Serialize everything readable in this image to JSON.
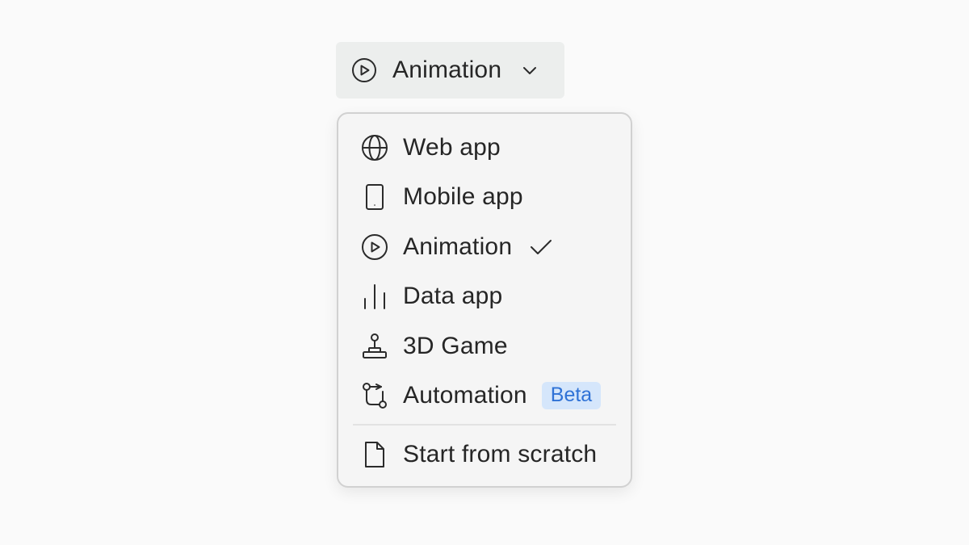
{
  "dropdown": {
    "selected_label": "Animation",
    "selected_icon": "play-circle-icon",
    "chevron_icon": "chevron-down-icon",
    "background": "#eceeed"
  },
  "menu": {
    "items": [
      {
        "label": "Web app",
        "icon": "globe-icon"
      },
      {
        "label": "Mobile app",
        "icon": "phone-icon"
      },
      {
        "label": "Animation",
        "icon": "play-circle-icon",
        "selected": true,
        "indicator_icon": "check-icon"
      },
      {
        "label": "Data app",
        "icon": "bar-chart-icon"
      },
      {
        "label": "3D Game",
        "icon": "joystick-icon"
      },
      {
        "label": "Automation",
        "icon": "workflow-icon",
        "badge": "Beta"
      }
    ],
    "footer_item": {
      "label": "Start from scratch",
      "icon": "file-icon"
    },
    "colors": {
      "badge_background": "#d5e6fb",
      "badge_text": "#2f72d6"
    }
  }
}
